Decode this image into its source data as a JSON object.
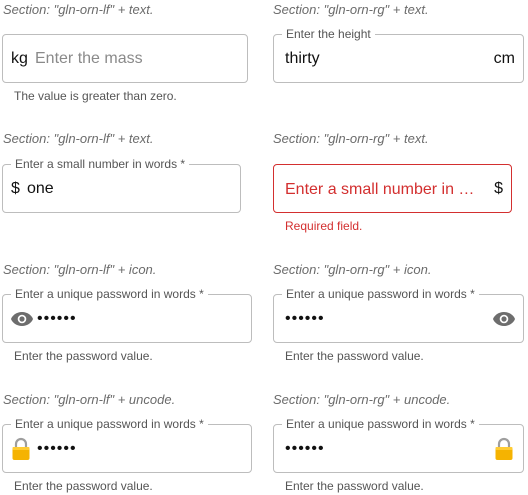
{
  "sections": [
    {
      "caption": "Section: \"gln-orn-lf\" + text.",
      "prefix": "kg",
      "placeholder": "Enter the mass",
      "helper": "The value is greater than zero."
    },
    {
      "caption": "Section: \"gln-orn-rg\" + text.",
      "legend": "Enter the height",
      "value": "thirty",
      "suffix": "cm"
    },
    {
      "caption": "Section: \"gln-orn-lf\" + text.",
      "legend": "Enter a small number in words *",
      "prefix": "$",
      "value": "one"
    },
    {
      "caption": "Section: \"gln-orn-rg\" + text.",
      "placeholder": "Enter a small number in w...",
      "suffix": "$",
      "helper": "Required field.",
      "error_color": "#d32f2f"
    },
    {
      "caption": "Section: \"gln-orn-lf\" + icon.",
      "legend": "Enter a unique password in words *",
      "icon": "eye-icon",
      "value": "••••••",
      "helper": "Enter the password value."
    },
    {
      "caption": "Section: \"gln-orn-rg\" + icon.",
      "legend": "Enter a unique password in words *",
      "icon": "eye-icon",
      "value": "••••••",
      "helper": "Enter the password value."
    },
    {
      "caption": "Section: \"gln-orn-lf\" + uncode.",
      "legend": "Enter a unique password in words *",
      "icon": "lock-icon",
      "value": "••••••",
      "helper": "Enter the password value."
    },
    {
      "caption": "Section: \"gln-orn-rg\" + uncode.",
      "legend": "Enter a unique password in words *",
      "icon": "lock-icon",
      "value": "••••••",
      "helper": "Enter the password value."
    }
  ]
}
